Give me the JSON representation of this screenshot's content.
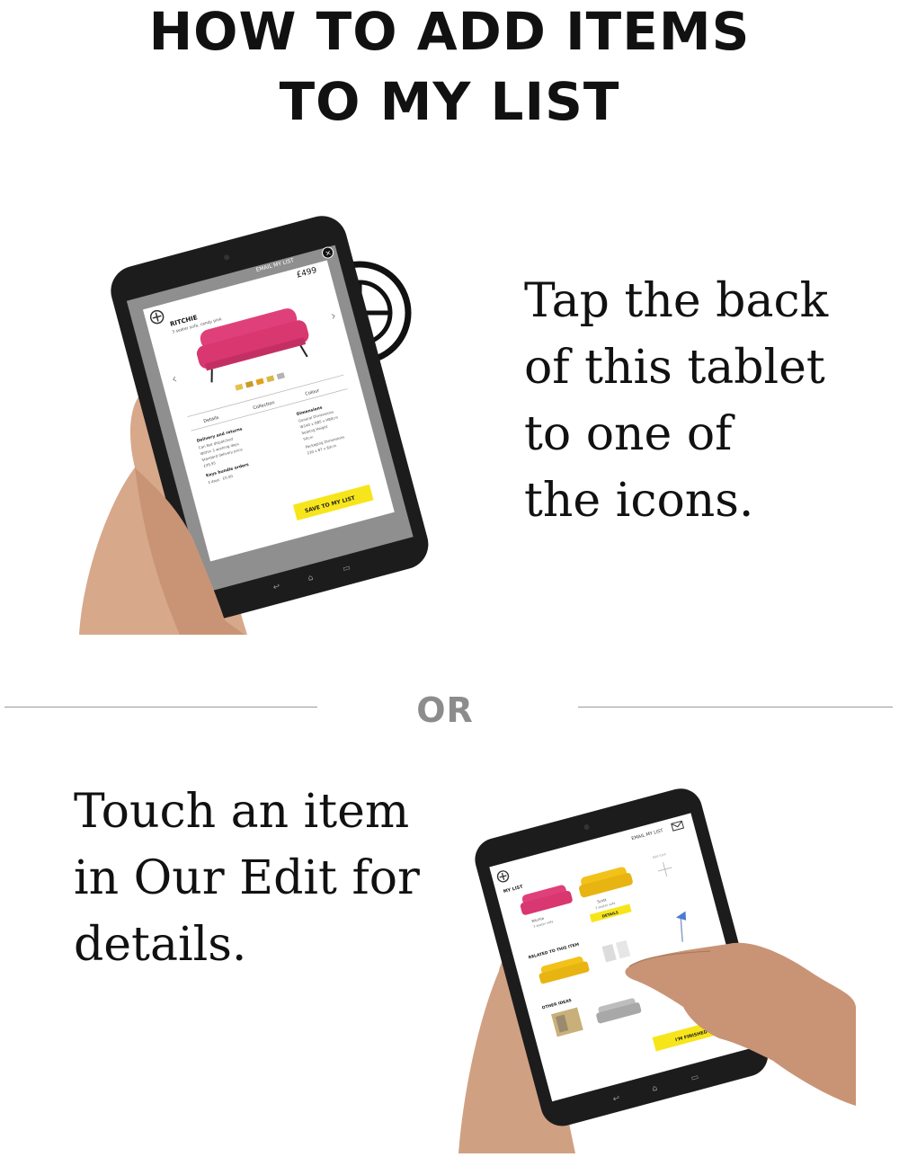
{
  "heading": {
    "line1": "HOW TO ADD ITEMS",
    "line2": "TO MY LIST"
  },
  "step1": {
    "lines": [
      "Tap the back",
      "of this tablet",
      "to one of",
      "the icons."
    ],
    "tablet": {
      "email_label": "EMAIL MY LIST",
      "product_name": "RITCHIE",
      "product_subtitle": "3 seater sofa, candy pink",
      "price": "£499",
      "tabs": [
        "Details",
        "Collection",
        "Colour"
      ],
      "details_heading": "Delivery and returns",
      "details_lines": [
        "Can Not dispatched",
        "Within 3 working days",
        "Standard delivery price",
        "£39.95"
      ],
      "dimensions_heading": "Dimensions",
      "dimensions_lines": [
        "General Dimensions",
        "W140 x D85 x H80cm",
        "Seating Height",
        "50cm",
        "Packaging Dimensions",
        "230 x 87 x 83cm"
      ],
      "extra_heading": "Keys bundle orders",
      "extra_line": "3 days · £0.00",
      "save_button": "SAVE TO MY LIST"
    }
  },
  "divider": {
    "label": "OR"
  },
  "step2": {
    "lines": [
      "Touch an item",
      "in Our Edit for",
      "details."
    ],
    "tablet": {
      "email_label": "EMAIL MY LIST",
      "my_list_label": "MY LIST",
      "add_label": "Add item",
      "item1_name": "Ritchie",
      "item1_sub": "3 seater sofa",
      "item2_name": "Scott",
      "item2_sub": "3 seater sofa",
      "details_button": "DETAILS",
      "related_heading": "RELATED TO THIS ITEM",
      "other_heading": "OTHER IDEAS",
      "finished_button": "I'M FINISHED"
    }
  },
  "colors": {
    "yellow": "#f7e51b",
    "pink": "#e0407a",
    "sofa_yellow": "#f2c21a",
    "tablet": "#1a1a1a"
  }
}
